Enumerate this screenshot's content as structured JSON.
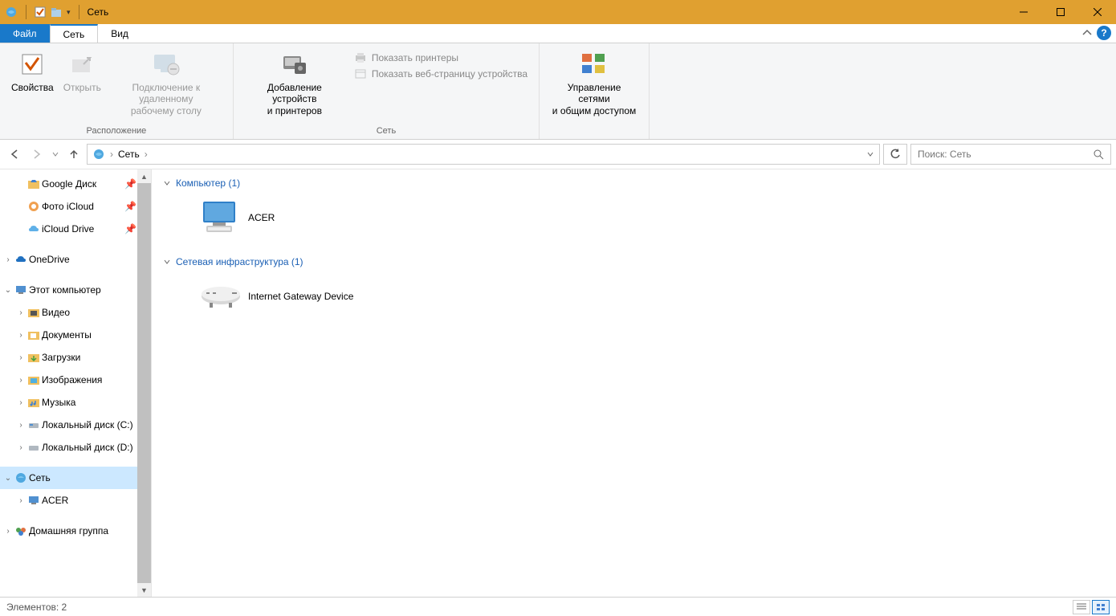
{
  "window": {
    "title": "Сеть"
  },
  "tabs": {
    "file": "Файл",
    "network": "Сеть",
    "view": "Вид"
  },
  "ribbon": {
    "location_group": "Расположение",
    "network_group": "Сеть",
    "properties": "Свойства",
    "open": "Открыть",
    "remote_desktop_l1": "Подключение к удаленному",
    "remote_desktop_l2": "рабочему столу",
    "add_devices_l1": "Добавление устройств",
    "add_devices_l2": "и принтеров",
    "show_printers": "Показать принтеры",
    "show_device_webpage": "Показать веб-страницу устройства",
    "network_center_l1": "Управление сетями",
    "network_center_l2": "и общим доступом"
  },
  "breadcrumb": {
    "root": "Сеть"
  },
  "search": {
    "placeholder": "Поиск: Сеть"
  },
  "sidebar": {
    "google_drive": "Google Диск",
    "photo_icloud": "Фото iCloud",
    "icloud_drive": "iCloud Drive",
    "onedrive": "OneDrive",
    "this_pc": "Этот компьютер",
    "videos": "Видео",
    "documents": "Документы",
    "downloads": "Загрузки",
    "pictures": "Изображения",
    "music": "Музыка",
    "local_disk1": "Локальный диск (C:)",
    "local_disk2": "Локальный диск (D:)",
    "network": "Сеть",
    "acer": "ACER",
    "homegroup": "Домашняя группа"
  },
  "content": {
    "group_computer": "Компьютер (1)",
    "computer_item": "ACER",
    "group_infra": "Сетевая инфраструктура (1)",
    "infra_item": "Internet Gateway Device"
  },
  "status": {
    "elements": "Элементов: 2"
  }
}
